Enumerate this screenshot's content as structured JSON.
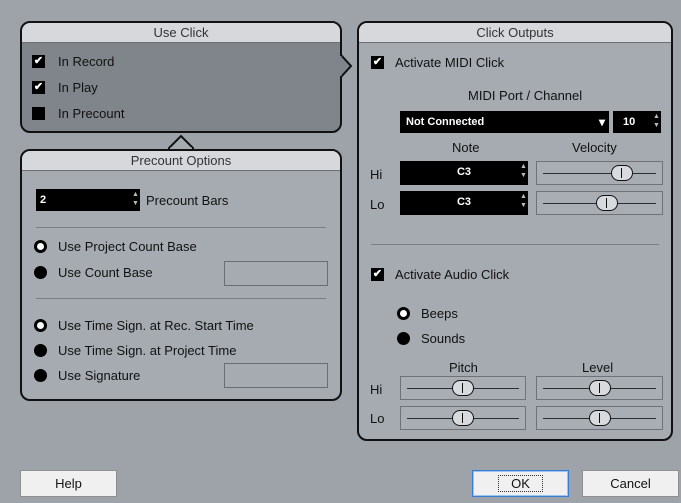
{
  "use_click": {
    "title": "Use Click",
    "options": [
      {
        "label": "In Record",
        "checked": true
      },
      {
        "label": "In Play",
        "checked": true
      },
      {
        "label": "In Precount",
        "checked": false
      }
    ]
  },
  "precount": {
    "title": "Precount Options",
    "bars_value": "2",
    "bars_label": "Precount Bars",
    "count_base": [
      {
        "label": "Use Project Count Base",
        "selected": true
      },
      {
        "label": "Use Count Base",
        "selected": false
      }
    ],
    "time_sign": [
      {
        "label": "Use Time Sign. at Rec. Start Time",
        "selected": true
      },
      {
        "label": "Use Time Sign. at Project Time",
        "selected": false
      },
      {
        "label": "Use Signature",
        "selected": false
      }
    ]
  },
  "click_outputs": {
    "title": "Click Outputs",
    "midi": {
      "activate_label": "Activate MIDI Click",
      "activate_checked": true,
      "port_channel_label": "MIDI Port / Channel",
      "port_value": "Not Connected",
      "channel_value": "10",
      "note_header": "Note",
      "velocity_header": "Velocity",
      "hi_label": "Hi",
      "lo_label": "Lo",
      "hi_note": "C3",
      "lo_note": "C3",
      "hi_velocity_fraction": 0.75,
      "lo_velocity_fraction": 0.58
    },
    "audio": {
      "activate_label": "Activate Audio Click",
      "activate_checked": true,
      "beeps_label": "Beeps",
      "sounds_label": "Sounds",
      "selected": "Beeps",
      "pitch_header": "Pitch",
      "level_header": "Level",
      "hi_label": "Hi",
      "lo_label": "Lo",
      "hi_pitch_fraction": 0.5,
      "lo_pitch_fraction": 0.5,
      "hi_level_fraction": 0.5,
      "lo_level_fraction": 0.5
    }
  },
  "buttons": {
    "help": "Help",
    "ok": "OK",
    "cancel": "Cancel"
  },
  "colors": {
    "background": "#9ea3aa",
    "panel": "#a6abb1",
    "use_click_panel": "#80858c",
    "header": "#d6d8dc",
    "field": "#000000",
    "ok_border": "#3a7bd5"
  },
  "icons": {
    "checkbox_mark": "✔",
    "dropdown_arrow": "▾",
    "spin_up": "▲",
    "spin_down": "▼"
  }
}
